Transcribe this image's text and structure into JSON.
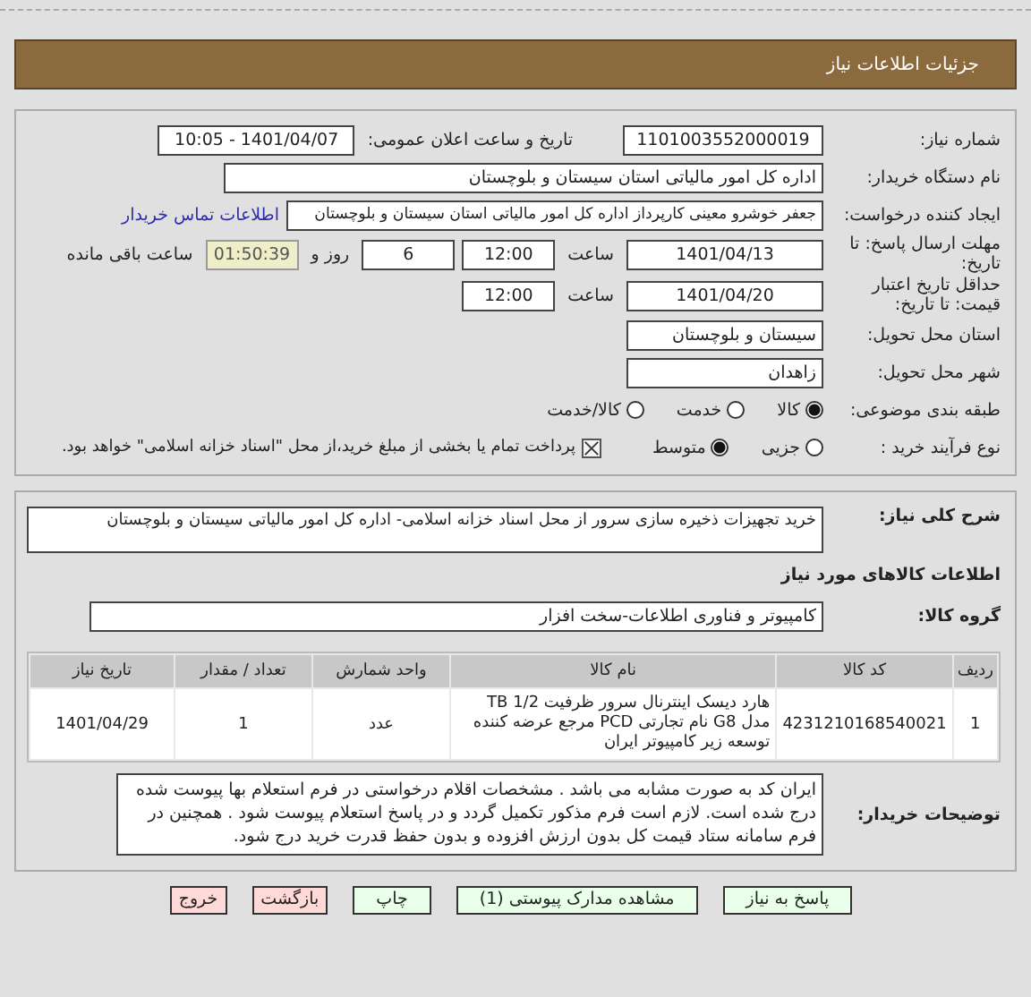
{
  "header": {
    "title": "جزئیات اطلاعات نیاز"
  },
  "details": {
    "need_number": {
      "label": "شماره نیاز:",
      "value": "1101003552000019"
    },
    "announce": {
      "label": "تاریخ و ساعت اعلان عمومی:",
      "value": "1401/04/07 - 10:05"
    },
    "buyer": {
      "label": "نام دستگاه خریدار:",
      "value": "اداره کل امور مالیاتی استان سیستان و بلوچستان"
    },
    "creator": {
      "label": "ایجاد کننده درخواست:",
      "value": "جعفر خوشرو معینی کارپرداز اداره کل امور مالیاتی استان سیستان و بلوچستان",
      "link": "اطلاعات تماس خریدار"
    },
    "deadline": {
      "label": "مهلت ارسال پاسخ: تا تاریخ:",
      "date": "1401/04/13",
      "time_label": "ساعت",
      "time": "12:00",
      "days": "6",
      "days_label": "روز و",
      "remaining": "01:50:39",
      "remaining_label": "ساعت باقی مانده"
    },
    "validity": {
      "label": "حداقل تاریخ اعتبار قیمت: تا تاریخ:",
      "date": "1401/04/20",
      "time_label": "ساعت",
      "time": "12:00"
    },
    "province": {
      "label": "استان محل تحویل:",
      "value": "سیستان و بلوچستان"
    },
    "city": {
      "label": "شهر محل تحویل:",
      "value": "زاهدان"
    },
    "category": {
      "label": "طبقه بندی موضوعی:",
      "options": [
        {
          "label": "کالا",
          "selected": true
        },
        {
          "label": "خدمت",
          "selected": false
        },
        {
          "label": "کالا/خدمت",
          "selected": false
        }
      ]
    },
    "process": {
      "label": "نوع فرآیند خرید :",
      "options": [
        {
          "label": "جزیی",
          "selected": false
        },
        {
          "label": "متوسط",
          "selected": true
        }
      ],
      "payment": {
        "checked": true,
        "text": "پرداخت تمام یا بخشی از مبلغ خرید،از محل \"اسناد خزانه اسلامی\" خواهد بود."
      }
    }
  },
  "needs": {
    "description": {
      "label": "شرح کلی نیاز:",
      "value": "خرید تجهیزات ذخیره سازی سرور از محل اسناد خزانه اسلامی- اداره کل امور مالیاتی سیستان و بلوچستان"
    },
    "goods_title": "اطلاعات کالاهای مورد نیاز",
    "group": {
      "label": "گروه کالا:",
      "value": "کامپیوتر و فناوری اطلاعات-سخت افزار"
    },
    "table": {
      "columns": [
        "ردیف",
        "کد کالا",
        "نام کالا",
        "واحد شمارش",
        "تعداد / مقدار",
        "تاریخ نیاز"
      ],
      "rows": [
        [
          "1",
          "4231210168540021",
          "هارد دیسک اینترنال سرور ظرفیت 1/2 TB مدل G8 نام تجارتی PCD مرجع عرضه کننده توسعه زیر کامپیوتر ایران",
          "عدد",
          "1",
          "1401/04/29"
        ]
      ]
    },
    "notes": {
      "label": "توضیحات خریدار:",
      "text": "ایران کد به صورت مشابه می باشد . مشخصات اقلام درخواستی در فرم استعلام بها پیوست شده درج شده است. لازم است فرم مذکور تکمیل گردد و در پاسخ استعلام پیوست شود . همچنین در فرم سامانه ستاد قیمت کل بدون ارزش افزوده و بدون حفظ قدرت خرید درج شود."
    }
  },
  "buttons": [
    {
      "label": "پاسخ به نیاز",
      "kind": "normal"
    },
    {
      "label": "مشاهده مدارک پیوستی (1)",
      "kind": "normal"
    },
    {
      "label": "چاپ",
      "kind": "normal"
    },
    {
      "label": "بازگشت",
      "kind": "danger"
    },
    {
      "label": "خروج",
      "kind": "danger"
    }
  ]
}
